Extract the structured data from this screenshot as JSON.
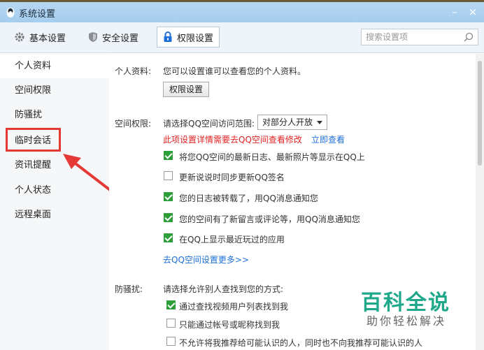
{
  "window": {
    "title": "系统设置",
    "minimize": "–",
    "close": "×"
  },
  "toolbar": {
    "tabs": [
      {
        "label": "基本设置",
        "icon": "gear-icon"
      },
      {
        "label": "安全设置",
        "icon": "shield-icon"
      },
      {
        "label": "权限设置",
        "icon": "lock-icon",
        "active": true
      }
    ],
    "search_placeholder": "搜索设置项"
  },
  "sidebar": {
    "items": [
      {
        "label": "个人资料",
        "selected": true
      },
      {
        "label": "空间权限"
      },
      {
        "label": "防骚扰"
      },
      {
        "label": "临时会话",
        "highlighted": true
      },
      {
        "label": "资讯提醒"
      },
      {
        "label": "个人状态"
      },
      {
        "label": "远程桌面"
      }
    ]
  },
  "profile": {
    "label": "个人资料:",
    "desc": "您可以设置谁可以查看您的个人资料。",
    "button": "权限设置"
  },
  "space": {
    "label": "空间权限:",
    "range_label": "请选择QQ空间访问范围:",
    "range_value": "对部分人开放",
    "notice": "此项设置详情需要去QQ空间查看修改",
    "view_link": "立即查看",
    "options": [
      {
        "label": "将您QQ空间的最新日志、最新照片等显示在QQ上",
        "checked": true
      },
      {
        "label": "更新说说时同步更新QQ签名",
        "checked": false
      },
      {
        "label": "您的日志被转载了，用QQ消息通知您",
        "checked": true
      },
      {
        "label": "您的空间有了新留言或评论等，用QQ消息通知您",
        "checked": true
      },
      {
        "label": "在QQ上显示最近玩过的应用",
        "checked": true
      }
    ],
    "more_link": "去QQ空间设置更多>>"
  },
  "anti_harass": {
    "label": "防骚扰:",
    "desc": "请选择允许别人查找到您的方式:",
    "options": [
      {
        "label": "通过查找视频用户列表找到我",
        "checked": true
      },
      {
        "label": "只能通过帐号或昵称找到我",
        "checked": false
      },
      {
        "label": "不允许将我推荐给可能认识的人，同时也不向我推荐可能认识的人",
        "checked": false
      }
    ]
  },
  "watermark": {
    "title": "百科全说",
    "subtitle": "助你轻松解决"
  },
  "colors": {
    "accent": "#1e6fd8",
    "warning": "#e22222",
    "checkbox": "#2e9e3a",
    "annotation": "#e53935",
    "watermark": "#1fa98a"
  }
}
